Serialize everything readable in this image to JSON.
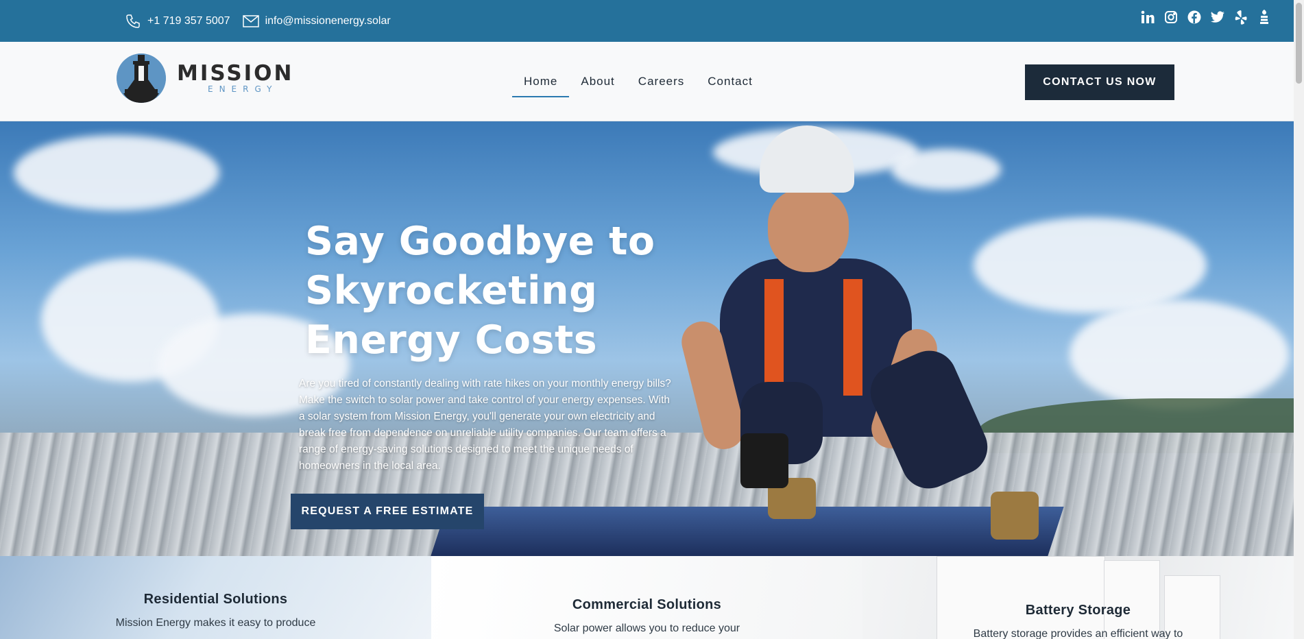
{
  "topbar": {
    "phone": "+1 719 357 5007",
    "email": "info@missionenergy.solar",
    "social": [
      "linkedin-icon",
      "instagram-icon",
      "facebook-icon",
      "twitter-icon",
      "yelp-icon",
      "bbb-icon"
    ]
  },
  "header": {
    "logo_main": "MISSION",
    "logo_sub": "ENERGY",
    "nav": [
      {
        "label": "Home",
        "active": true
      },
      {
        "label": "About",
        "active": false
      },
      {
        "label": "Careers",
        "active": false
      },
      {
        "label": "Contact",
        "active": false
      }
    ],
    "cta_label": "CONTACT US NOW"
  },
  "hero": {
    "title": "Say Goodbye to Skyrocketing Energy Costs",
    "text": "Are you tired of constantly dealing with rate hikes on your monthly energy bills? Make the switch to solar power and take control of your energy expenses. With a solar system from Mission Energy, you'll generate your own electricity and break free from dependence on unreliable utility companies. Our team offers a range of energy-saving solutions designed to meet the unique needs of homeowners in the local area.",
    "button_label": "REQUEST A FREE ESTIMATE"
  },
  "services": [
    {
      "title": "Residential Solutions",
      "text": "Mission Energy makes it easy to produce"
    },
    {
      "title": "Commercial Solutions",
      "text": "Solar power allows you to reduce your"
    },
    {
      "title": "Battery Storage",
      "text": "Battery storage provides an efficient way to"
    }
  ],
  "colors": {
    "topbar": "#25719b",
    "header_bg": "#f8f9fa",
    "cta_bg": "#1c2b3a",
    "hero_button": "#25456b",
    "accent": "#2a7ab0"
  }
}
